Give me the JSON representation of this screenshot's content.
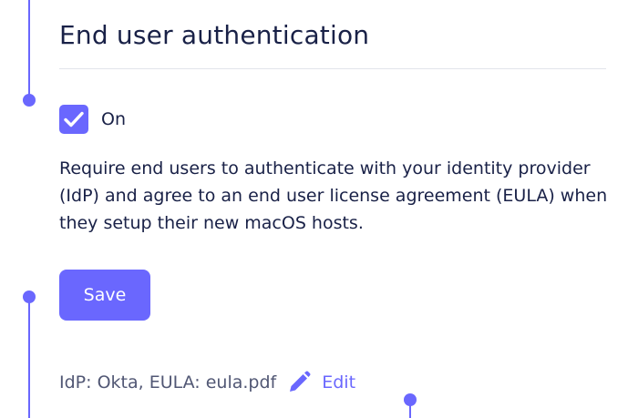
{
  "section": {
    "title": "End user authentication"
  },
  "toggle": {
    "label": "On",
    "checked": true
  },
  "description": "Require end users to authenticate with your identity provider (IdP) and agree to an end user license agreement (EULA) when they setup their new macOS hosts.",
  "actions": {
    "save_label": "Save"
  },
  "status": {
    "summary": "IdP: Okta, EULA: eula.pdf",
    "edit_label": "Edit",
    "edit_icon": "pencil-icon"
  },
  "colors": {
    "accent": "#6a67fe",
    "text": "#192147",
    "muted_text": "#515774",
    "divider": "#e2e4ea"
  }
}
